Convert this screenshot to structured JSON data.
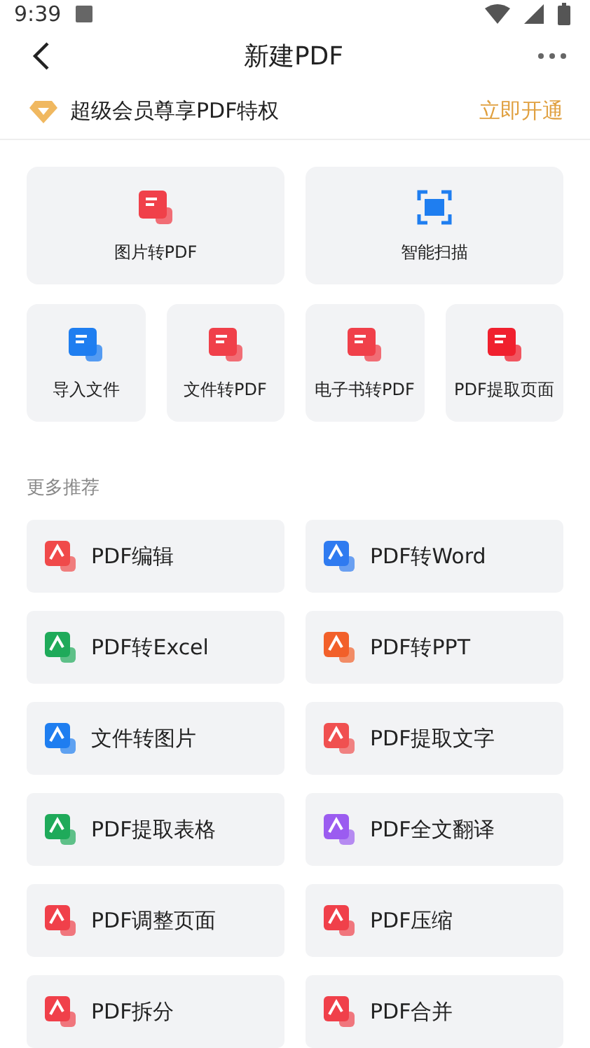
{
  "status_bar": {
    "time": "9:39"
  },
  "header": {
    "title": "新建PDF"
  },
  "vip_banner": {
    "text": "超级会员尊享PDF特权",
    "action": "立即开通"
  },
  "tools": [
    {
      "label": "图片转PDF",
      "color": "#f0404a",
      "kind": "large"
    },
    {
      "label": "智能扫描",
      "color": "#1f7ef0",
      "kind": "large"
    },
    {
      "label": "导入文件",
      "color": "#1f7ef0",
      "kind": "small"
    },
    {
      "label": "文件转PDF",
      "color": "#f0404a",
      "kind": "small"
    },
    {
      "label": "电子书转PDF",
      "color": "#f0404a",
      "kind": "small"
    },
    {
      "label": "PDF提取页面",
      "color": "#f0202e",
      "kind": "small"
    }
  ],
  "section_title": "更多推荐",
  "features": [
    {
      "label": "PDF编辑",
      "color": "#f04a4a"
    },
    {
      "label": "PDF转Word",
      "color": "#2f7bf0"
    },
    {
      "label": "PDF转Excel",
      "color": "#1faa5a"
    },
    {
      "label": "PDF转PPT",
      "color": "#f2602a"
    },
    {
      "label": "文件转图片",
      "color": "#1f7ef0"
    },
    {
      "label": "PDF提取文字",
      "color": "#f05050"
    },
    {
      "label": "PDF提取表格",
      "color": "#1faa5a"
    },
    {
      "label": "PDF全文翻译",
      "color": "#9b5cf0"
    },
    {
      "label": "PDF调整页面",
      "color": "#f0404a"
    },
    {
      "label": "PDF压缩",
      "color": "#f0404a"
    },
    {
      "label": "PDF拆分",
      "color": "#f0404a"
    },
    {
      "label": "PDF合并",
      "color": "#f0404a"
    }
  ]
}
